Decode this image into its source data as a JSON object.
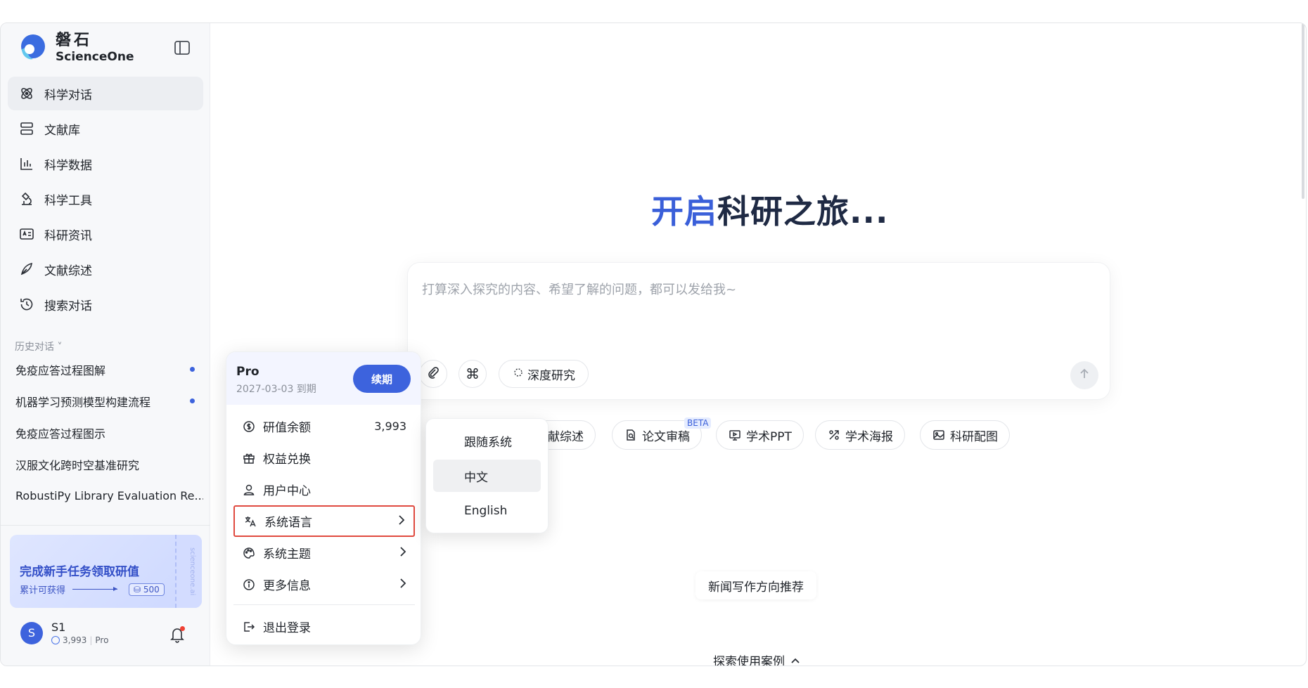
{
  "brand": {
    "name_cn": "磐石",
    "name_en": "ScienceOne"
  },
  "nav": [
    {
      "label": "科学对话",
      "icon": "atom-icon",
      "active": true
    },
    {
      "label": "文献库",
      "icon": "library-icon"
    },
    {
      "label": "科学数据",
      "icon": "chart-icon"
    },
    {
      "label": "科学工具",
      "icon": "microscope-icon"
    },
    {
      "label": "科研资讯",
      "icon": "news-icon"
    },
    {
      "label": "文献综述",
      "icon": "pen-icon"
    },
    {
      "label": "搜索对话",
      "icon": "history-icon"
    }
  ],
  "history": {
    "label": "历史对话",
    "items": [
      {
        "title": "免疫应答过程图解",
        "unread": true
      },
      {
        "title": "机器学习预测模型构建流程",
        "unread": true
      },
      {
        "title": "免疫应答过程图示",
        "unread": false
      },
      {
        "title": "汉服文化跨时空基准研究",
        "unread": false
      },
      {
        "title": "RobustiPy Library Evaluation Re...",
        "unread": false
      }
    ]
  },
  "promo": {
    "title": "完成新手任务领取研值",
    "subtitle": "累计可获得",
    "reward": "500",
    "side_text": "scienceone.ai"
  },
  "user": {
    "initial": "S",
    "name": "S1",
    "balance": "3,993",
    "plan": "Pro"
  },
  "main": {
    "hero_blue": "开启",
    "hero_dark": "科研之旅...",
    "input_placeholder": "打算深入探究的内容、希望了解的问题，都可以发给我~",
    "deep_research": "深度研究",
    "chips": [
      {
        "label": "文献综述",
        "icon": "pen-icon"
      },
      {
        "label": "论文审稿",
        "icon": "doc-search-icon"
      },
      {
        "label": "学术PPT",
        "icon": "presentation-icon"
      },
      {
        "label": "学术海报",
        "icon": "poster-icon"
      },
      {
        "label": "科研配图",
        "icon": "image-icon"
      }
    ],
    "beta": "BETA",
    "news_chip": "新闻写作方向推荐",
    "explore": "探索使用案例"
  },
  "popup": {
    "plan": "Pro",
    "expiry": "2027-03-03 到期",
    "renew": "续期",
    "items": [
      {
        "label": "研值余额",
        "value": "3,993",
        "icon": "coin-icon"
      },
      {
        "label": "权益兑换",
        "icon": "gift-icon"
      },
      {
        "label": "用户中心",
        "icon": "user-icon"
      },
      {
        "label": "系统语言",
        "icon": "translate-icon",
        "arrow": true
      },
      {
        "label": "系统主题",
        "icon": "palette-icon",
        "arrow": true
      },
      {
        "label": "更多信息",
        "icon": "info-icon",
        "arrow": true
      }
    ],
    "logout": "退出登录"
  },
  "language_menu": {
    "options": [
      "跟随系统",
      "中文",
      "English"
    ],
    "selected": "中文"
  },
  "colors": {
    "accent": "#3d63dd",
    "highlight_border": "#e04a3f"
  }
}
